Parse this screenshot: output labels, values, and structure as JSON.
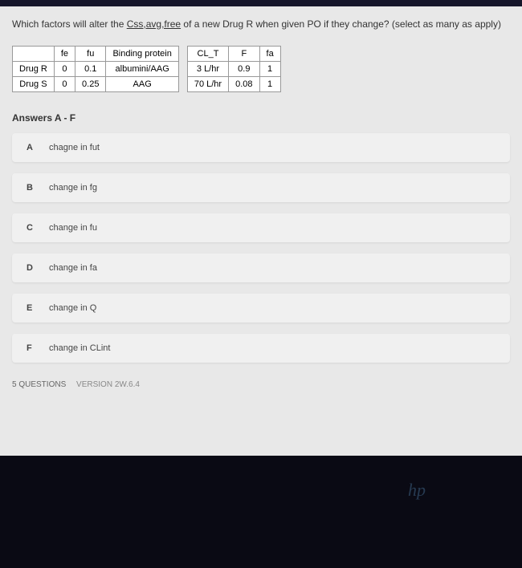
{
  "question": {
    "prefix": "Which factors will alter the ",
    "underlined": "Css,avg,free",
    "suffix": " of a new Drug R when given PO if they change? (select as many as apply)"
  },
  "table1": {
    "headers": [
      "",
      "fe",
      "fu",
      "Binding protein"
    ],
    "rows": [
      [
        "Drug R",
        "0",
        "0.1",
        "albumini/AAG"
      ],
      [
        "Drug S",
        "0",
        "0.25",
        "AAG"
      ]
    ]
  },
  "table2": {
    "headers": [
      "CL_T",
      "F",
      "fa"
    ],
    "rows": [
      [
        "3 L/hr",
        "0.9",
        "1"
      ],
      [
        "70 L/hr",
        "0.08",
        "1"
      ]
    ]
  },
  "answers_header": "Answers A - F",
  "answers": [
    {
      "letter": "A",
      "text": "chagne in fut"
    },
    {
      "letter": "B",
      "text": "change in fg"
    },
    {
      "letter": "C",
      "text": "change in fu"
    },
    {
      "letter": "D",
      "text": "change in fa"
    },
    {
      "letter": "E",
      "text": "change in Q"
    },
    {
      "letter": "F",
      "text": "change in CLint"
    }
  ],
  "footer": {
    "questions": "5 QUESTIONS",
    "version": "VERSION 2W.6.4"
  },
  "logo": "hp"
}
